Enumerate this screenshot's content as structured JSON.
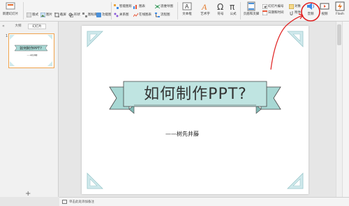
{
  "ribbon": {
    "new_slide": "新建幻灯片",
    "theme": "版式",
    "picture": "图片",
    "screenshot": "截屏",
    "shape": "形状",
    "icon_lib": "图标库",
    "func_icon": "功能图",
    "smart_art": "智能图形",
    "chart": "图表",
    "mind_map": "思维导图",
    "relation_map": "关系图",
    "online_chart": "在线图表",
    "flowchart": "流程图",
    "text_box": "文本框",
    "art_text": "艺术字",
    "symbol": "符号",
    "formula": "公式",
    "page_header_footer": "页眉和页脚",
    "slide_number": "幻灯片编号",
    "object": "对象",
    "date_time": "日期和时间",
    "attachment": "附件",
    "audio": "音频",
    "video": "视频",
    "flash": "Flash"
  },
  "left_pane": {
    "tab_outline": "大纲",
    "tab_slides": "幻灯片",
    "thumb_number": "1",
    "add_icon": "+"
  },
  "slide": {
    "title": "如何制作PPT?",
    "subtitle": "——树先井藤"
  },
  "notes": {
    "placeholder": "单击此处添加备注"
  },
  "colors": {
    "ribbon_accent": "#a8d8d4",
    "ribbon_border": "#444444",
    "corner_fill": "#cfe9ec",
    "annotation_red": "#e02020",
    "thumb_border": "#f0a24b"
  }
}
